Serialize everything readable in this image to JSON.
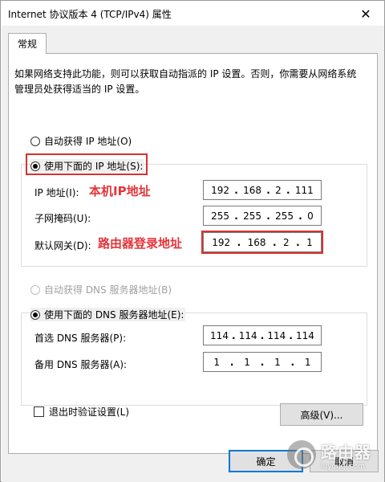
{
  "window": {
    "title": "Internet 协议版本 4 (TCP/IPv4) 属性",
    "close_glyph": "✕"
  },
  "tabs": [
    {
      "label": "常规"
    }
  ],
  "description": "如果网络支持此功能，则可以获取自动指派的 IP 设置。否则，你需要从网络系统管理员处获得适当的 IP 设置。",
  "ip_section": {
    "auto_option": "自动获得 IP 地址(O)",
    "manual_option": "使用下面的 IP 地址(S):",
    "selected": "manual",
    "fields": [
      {
        "label": "IP 地址(I):",
        "octets": [
          "192",
          "168",
          "2",
          "111"
        ]
      },
      {
        "label": "子网掩码(U):",
        "octets": [
          "255",
          "255",
          "255",
          "0"
        ]
      },
      {
        "label": "默认网关(D):",
        "octets": [
          "192",
          "168",
          "2",
          "1"
        ]
      }
    ]
  },
  "dns_section": {
    "auto_option": "自动获得 DNS 服务器地址(B)",
    "manual_option": "使用下面的 DNS 服务器地址(E):",
    "selected": "manual",
    "fields": [
      {
        "label": "首选 DNS 服务器(P):",
        "octets": [
          "114",
          "114",
          "114",
          "114"
        ]
      },
      {
        "label": "备用 DNS 服务器(A):",
        "octets": [
          "1",
          "1",
          "1",
          "1"
        ]
      }
    ]
  },
  "annotations": {
    "local_ip": "本机IP地址",
    "router_login": "路由器登录地址",
    "color": "#e5343a"
  },
  "validate_checkbox": {
    "label": "退出时验证设置(L)",
    "checked": false
  },
  "buttons": {
    "advanced": "高级(V)...",
    "ok": "确定",
    "cancel": "取消"
  },
  "watermark": {
    "main": "路由器",
    "sub": "luyouqi.com"
  },
  "colors": {
    "accent": "#0078d7",
    "highlight_red": "#d9312f",
    "dialog_bg": "#f0f0f0"
  }
}
